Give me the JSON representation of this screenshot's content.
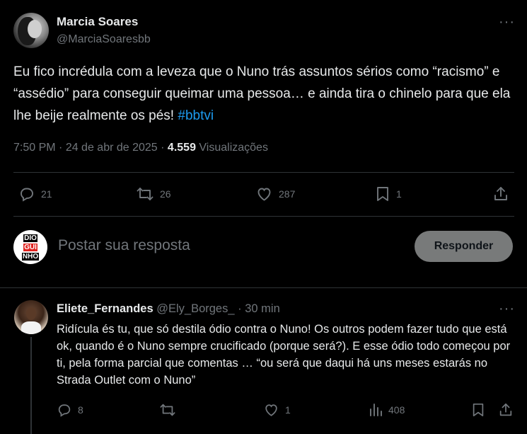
{
  "tweet": {
    "author_name": "Marcia Soares",
    "author_handle": "@MarciaSoaresbb",
    "more_label": "···",
    "text": "Eu fico incrédula com a leveza que o Nuno trás assuntos sérios como “racismo” e “assédio” para conseguir queimar uma pessoa… e ainda tira o chinelo para que ela lhe beije realmente os pés! ",
    "hashtag": "#bbtvi",
    "time": "7:50 PM",
    "separator": " · ",
    "date": "24 de abr de 2025",
    "views_count": "4.559",
    "views_label": " Visualizações",
    "replies": "21",
    "retweets": "26",
    "likes": "287",
    "bookmarks": "1"
  },
  "compose": {
    "avatar_letters": [
      "DIO",
      "GUI",
      "NHO"
    ],
    "placeholder": "Postar sua resposta",
    "button_label": "Responder"
  },
  "reply": {
    "author_name": "Eliete_Fernandes",
    "author_handle": "@Ely_Borges_",
    "separator": " · ",
    "time": "30 min",
    "more_label": "···",
    "text": "Ridícula és tu, que só destila ódio contra  o Nuno! Os outros podem fazer tudo que está ok, quando é o Nuno sempre crucificado (porque será?). E esse ódio todo começou por ti, pela forma parcial que comentas … “ou será que daqui há uns meses estarás no Strada Outlet com o Nuno”",
    "replies": "8",
    "retweets": "",
    "likes": "1",
    "views": "408"
  },
  "colors": {
    "background": "#000000",
    "text": "#e7e9ea",
    "muted": "#71767b",
    "link": "#1d9bf0",
    "divider": "#2f3336",
    "button": "#787a7a"
  },
  "icons": [
    "more-icon",
    "reply-icon",
    "retweet-icon",
    "like-icon",
    "bookmark-icon",
    "share-icon",
    "views-icon"
  ]
}
